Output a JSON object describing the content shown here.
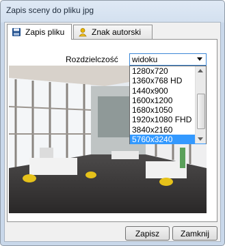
{
  "window": {
    "title": "Zapis sceny do pliku jpg"
  },
  "tabs": [
    {
      "label": "Zapis pliku",
      "icon": "floppy-disk-icon",
      "active": true
    },
    {
      "label": "Znak autorski",
      "icon": "copyright-user-icon",
      "active": false
    }
  ],
  "resolution": {
    "label": "Rozdzielczość",
    "selected_value": "widoku",
    "options": [
      "1280x720",
      "1360x768 HD",
      "1440x900",
      "1600x1200",
      "1680x1050",
      "1920x1080 FHD",
      "3840x2160",
      "5760x3240"
    ],
    "highlighted": "5760x3240"
  },
  "buttons": {
    "save_label": "Zapisz",
    "close_label": "Zamknij"
  },
  "colors": {
    "accent": "#3399ff",
    "title_bg": "#dfe9f5"
  }
}
